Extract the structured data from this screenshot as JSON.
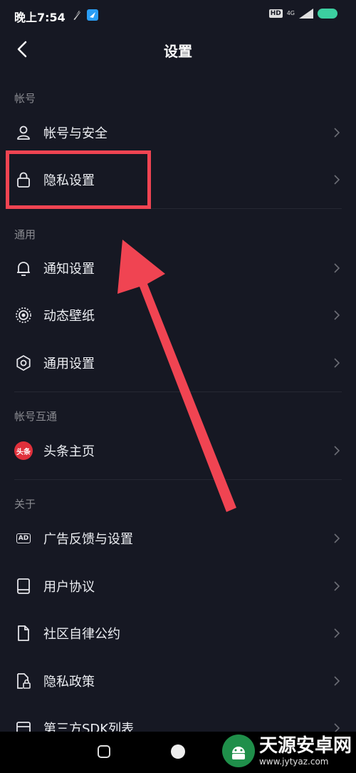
{
  "status_bar": {
    "time": "晚上7:54",
    "hd": "HD",
    "network": "4G"
  },
  "header": {
    "title": "设置"
  },
  "sections": [
    {
      "label": "帐号",
      "items": [
        {
          "label": "帐号与安全",
          "icon": "user-icon"
        },
        {
          "label": "隐私设置",
          "icon": "lock-icon"
        }
      ]
    },
    {
      "label": "通用",
      "items": [
        {
          "label": "通知设置",
          "icon": "bell-icon"
        },
        {
          "label": "动态壁纸",
          "icon": "wallpaper-icon"
        },
        {
          "label": "通用设置",
          "icon": "gear-icon"
        }
      ]
    },
    {
      "label": "帐号互通",
      "items": [
        {
          "label": "头条主页",
          "icon": "toutiao-icon",
          "icon_text": "头条"
        }
      ]
    },
    {
      "label": "关于",
      "items": [
        {
          "label": "广告反馈与设置",
          "icon": "ad-icon",
          "icon_text": "AD"
        },
        {
          "label": "用户协议",
          "icon": "book-icon"
        },
        {
          "label": "社区自律公约",
          "icon": "document-icon"
        },
        {
          "label": "隐私政策",
          "icon": "privacy-doc-icon"
        },
        {
          "label": "第三方SDK列表",
          "icon": "list-icon"
        }
      ]
    }
  ],
  "watermark": {
    "name": "天源安卓网",
    "url": "www.jytyaz.com"
  },
  "colors": {
    "background": "#161823",
    "highlight": "#f04452",
    "text": "#eceef2",
    "section": "#8a8b91"
  }
}
